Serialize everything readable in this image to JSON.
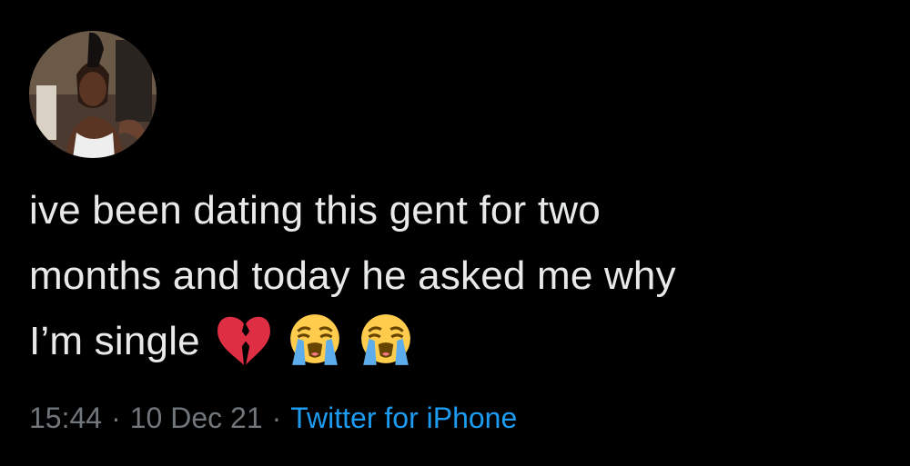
{
  "tweet": {
    "text_lines": [
      "ive been dating this gent for two",
      "months and today he asked me why",
      "I’m single"
    ],
    "emojis": [
      "broken-heart-icon",
      "loudly-crying-face-icon",
      "loudly-crying-face-icon"
    ],
    "time": "15:44",
    "date": "10 Dec 21",
    "separator": "·",
    "source": "Twitter for iPhone"
  },
  "colors": {
    "background": "#000000",
    "text": "#e7e9ea",
    "muted": "#71767b",
    "link": "#1d9bf0"
  }
}
